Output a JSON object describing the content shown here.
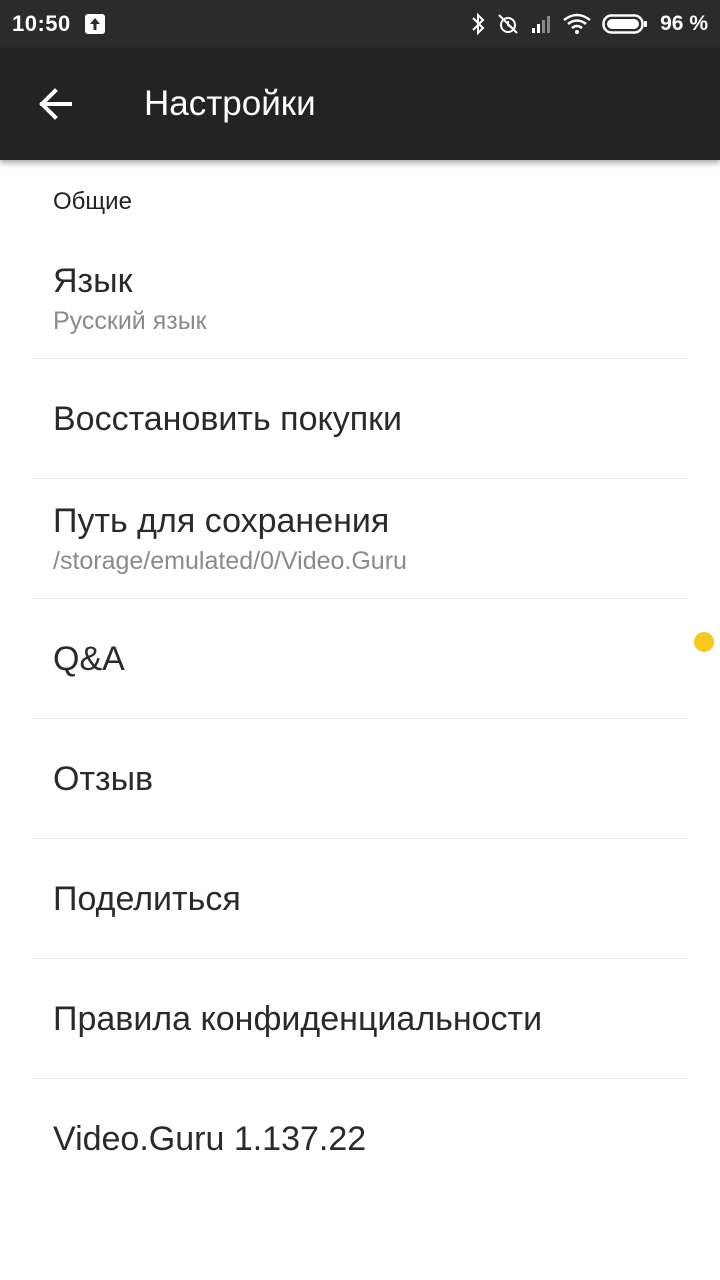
{
  "status_bar": {
    "time": "10:50",
    "battery": "96 %"
  },
  "app_bar": {
    "title": "Настройки"
  },
  "settings": {
    "section_header": "Общие",
    "language": {
      "title": "Язык",
      "value": "Русский язык"
    },
    "restore_purchases": {
      "title": "Восстановить покупки"
    },
    "save_path": {
      "title": "Путь для сохранения",
      "value": "/storage/emulated/0/Video.Guru"
    },
    "qa": {
      "title": "Q&A",
      "badge_color": "#f9c821"
    },
    "feedback": {
      "title": "Отзыв"
    },
    "share": {
      "title": "Поделиться"
    },
    "privacy": {
      "title": "Правила конфиденциальности"
    },
    "version": {
      "title": "Video.Guru 1.137.22"
    }
  },
  "icons": {
    "back": "arrow-left-icon",
    "upload": "upload-icon",
    "bluetooth": "bluetooth-icon",
    "alarm_off": "alarm-off-icon",
    "signal": "signal-icon",
    "wifi": "wifi-icon",
    "battery": "battery-icon"
  },
  "colors": {
    "status_bar": "#2b2b2b",
    "app_bar": "#232323",
    "accent_badge": "#f9c821"
  }
}
